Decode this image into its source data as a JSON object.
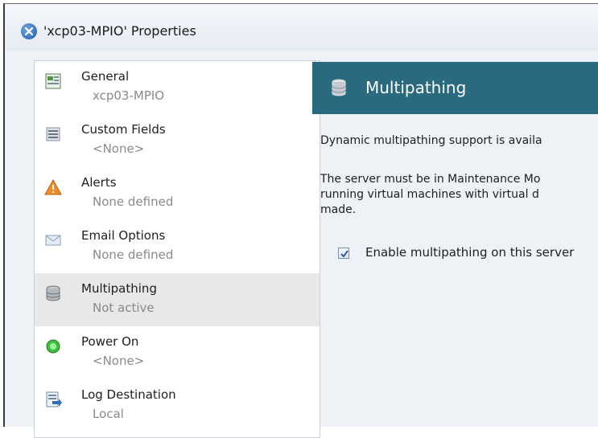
{
  "window": {
    "title": "'xcp03-MPIO' Properties"
  },
  "sidebar": {
    "items": [
      {
        "label": "General",
        "sub": "xcp03-MPIO",
        "icon": "general-icon",
        "selected": false
      },
      {
        "label": "Custom Fields",
        "sub": "<None>",
        "icon": "custom-fields-icon",
        "selected": false
      },
      {
        "label": "Alerts",
        "sub": "None defined",
        "icon": "alert-icon",
        "selected": false
      },
      {
        "label": "Email Options",
        "sub": "None defined",
        "icon": "email-icon",
        "selected": false
      },
      {
        "label": "Multipathing",
        "sub": "Not active",
        "icon": "multipathing-icon",
        "selected": true
      },
      {
        "label": "Power On",
        "sub": "<None>",
        "icon": "power-on-icon",
        "selected": false
      },
      {
        "label": "Log Destination",
        "sub": "Local",
        "icon": "log-destination-icon",
        "selected": false
      }
    ]
  },
  "panel": {
    "title": "Multipathing",
    "icon": "multipathing-icon",
    "line1": "Dynamic multipathing support is availa",
    "line2": "The server must be in Maintenance Mo",
    "line3": "running virtual machines with virtual d",
    "line4": "made.",
    "checkbox_label": "Enable multipathing on this server",
    "checkbox_checked": true
  },
  "colors": {
    "header_bg": "#2a6a7e",
    "selected_bg": "#e8e8e8",
    "window_bg": "#eef2f7"
  }
}
